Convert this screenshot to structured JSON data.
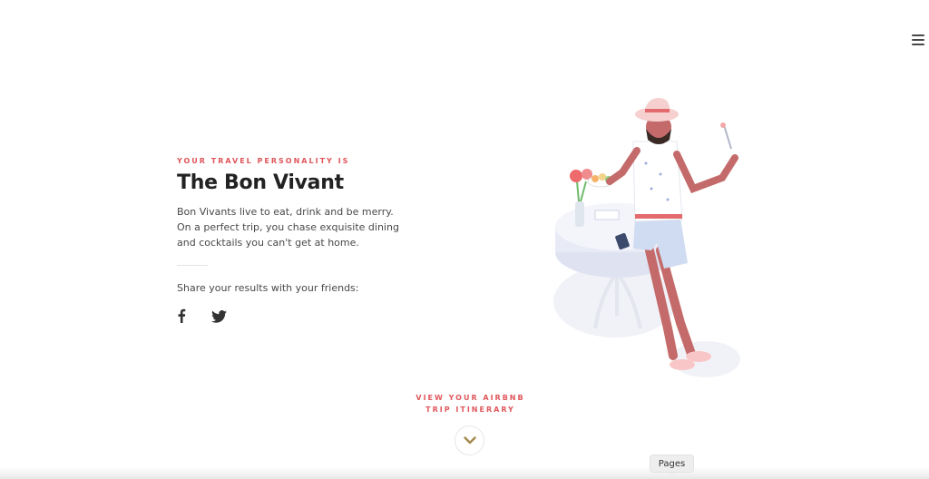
{
  "header": {
    "menu_icon": "hamburger-menu-icon"
  },
  "result": {
    "eyebrow": "YOUR TRAVEL PERSONALITY IS",
    "title": "The Bon Vivant",
    "description": "Bon Vivants live to eat, drink and be merry. On a perfect trip, you chase exquisite dining and cocktails you can't get at home.",
    "share_text": "Share your results with your friends:",
    "share_icons": [
      "facebook-icon",
      "twitter-icon"
    ]
  },
  "illustration": {
    "subject": "illustration of a man in a hat holding a fork beside a café table with flowers and a plate of food"
  },
  "itinerary": {
    "link_label": "VIEW YOUR AIRBNB TRIP ITINERARY",
    "scroll_icon": "chevron-down-icon",
    "accent_color": "#e0565b",
    "chevron_color": "#a38a4a"
  },
  "overlay": {
    "pages_label": "Pages"
  }
}
